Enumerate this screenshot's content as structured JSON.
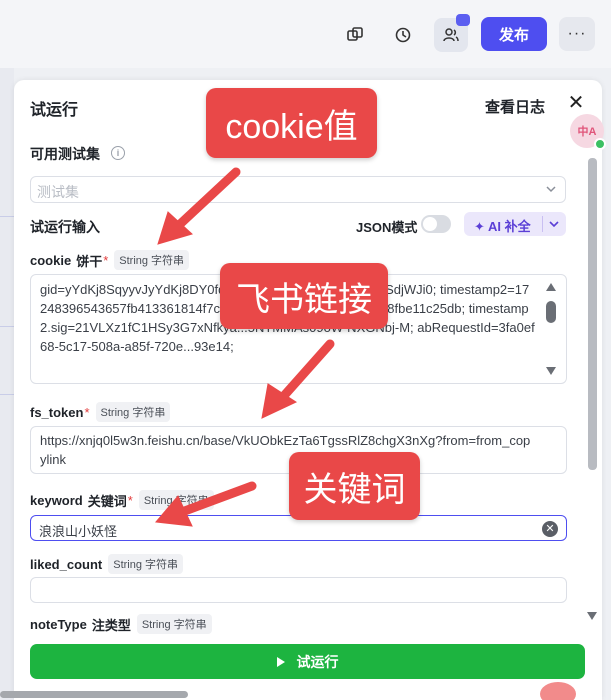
{
  "topbar": {
    "publish_label": "发布",
    "more_label": "···"
  },
  "panel": {
    "title": "试运行",
    "log_link": "查看日志",
    "close_label": "✕",
    "test_set_label": "可用测试集",
    "test_set_placeholder": "测试集",
    "input_section_label": "试运行输入",
    "json_mode_label": "JSON模式",
    "ai_button_label": "✦ AI 补全",
    "run_button_label": "试运行"
  },
  "fields": [
    {
      "name": "cookie",
      "desc": "饼干",
      "required": "*",
      "type": "String 字符串",
      "value": "gid=yYdKj8SqyyvJyYdKj8DY0fq...K283kC1hd888qJK2j28WSdjWJi0; timestamp2=17248396543657fb413361814f7c6f1137da11f54f7ed3c0e19398fbe11c25db; timestamp2.sig=21VLXz1fC1HSy3G7xNfkya...5NTMMAs09oW-NXGNbj-M; abRequestId=3fa0ef68-5c17-508a-a85f-720e...93e14;"
    },
    {
      "name": "fs_token",
      "desc": "",
      "required": "*",
      "type": "String 字符串",
      "value": "https://xnjq0l5w3n.feishu.cn/base/VkUObkEzTa6TgssRlZ8chgX3nXg?from=from_copylink"
    },
    {
      "name": "keyword",
      "desc": "关键词",
      "required": "*",
      "type": "String 字符串",
      "value": "浪浪山小妖怪"
    },
    {
      "name": "liked_count",
      "desc": "",
      "required": "",
      "type": "String 字符串",
      "value": ""
    },
    {
      "name": "noteType",
      "desc": "注类型",
      "required": "",
      "type": "String 字符串",
      "value": ""
    }
  ],
  "annotations": {
    "cookie_callout": "cookie值",
    "feishu_callout": "飞书链接",
    "keyword_callout": "关键词"
  },
  "floater": {
    "label": "中A"
  },
  "colors": {
    "publish": "#4e4ef0",
    "run": "#1db440",
    "callout": "#e94848",
    "ai_text": "#5b3fd6"
  }
}
